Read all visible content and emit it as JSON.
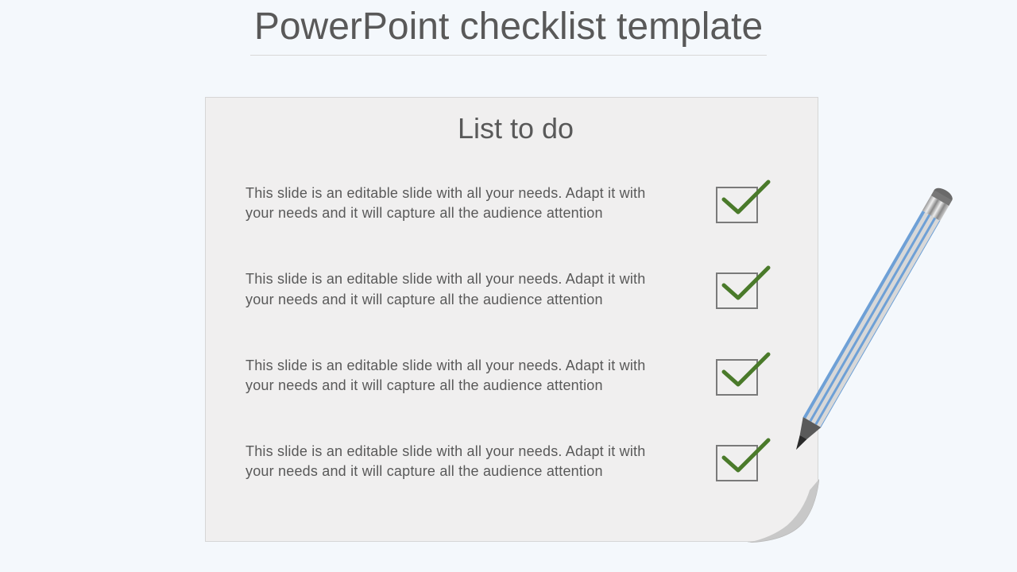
{
  "title": "PowerPoint checklist template",
  "list_title": "List to do",
  "items": [
    {
      "text": "This slide is an editable slide with all your needs. Adapt it with your needs and it will capture all the audience attention",
      "checked": true
    },
    {
      "text": "This slide is an editable slide with all your needs. Adapt it with your needs and it will capture all the audience attention",
      "checked": true
    },
    {
      "text": "This slide is an editable slide with all your needs. Adapt it with your needs and it will capture all the audience attention",
      "checked": true
    },
    {
      "text": "This slide is an editable slide with all your needs. Adapt it with your needs and it will capture all the audience attention",
      "checked": true
    }
  ]
}
